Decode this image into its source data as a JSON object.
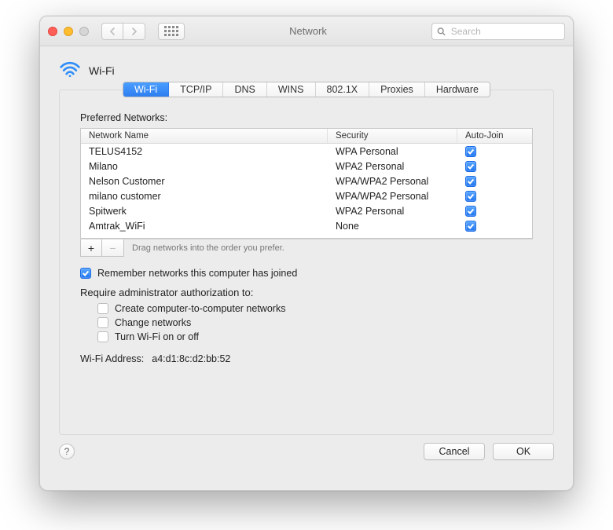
{
  "titlebar": {
    "title": "Network",
    "search_placeholder": "Search"
  },
  "header": {
    "title": "Wi-Fi"
  },
  "tabs": {
    "wifi": "Wi-Fi",
    "tcpip": "TCP/IP",
    "dns": "DNS",
    "wins": "WINS",
    "8021x": "802.1X",
    "proxies": "Proxies",
    "hardware": "Hardware"
  },
  "panel": {
    "preferred_label": "Preferred Networks:",
    "columns": {
      "name": "Network Name",
      "security": "Security",
      "autojoin": "Auto-Join"
    },
    "networks": [
      {
        "name": "TELUS4152",
        "security": "WPA Personal",
        "autojoin": true
      },
      {
        "name": "Milano",
        "security": "WPA2 Personal",
        "autojoin": true
      },
      {
        "name": "Nelson Customer",
        "security": "WPA/WPA2 Personal",
        "autojoin": true
      },
      {
        "name": "milano customer",
        "security": "WPA/WPA2 Personal",
        "autojoin": true
      },
      {
        "name": "Spitwerk",
        "security": "WPA2 Personal",
        "autojoin": true
      },
      {
        "name": "Amtrak_WiFi",
        "security": "None",
        "autojoin": true
      }
    ],
    "drag_hint": "Drag networks into the order you prefer.",
    "remember_label": "Remember networks this computer has joined",
    "remember_checked": true,
    "require_admin_label": "Require administrator authorization to:",
    "admin_opts": {
      "create": "Create computer-to-computer networks",
      "change": "Change networks",
      "toggle": "Turn Wi-Fi on or off"
    },
    "wifi_addr_label": "Wi-Fi Address:",
    "wifi_addr_value": "a4:d1:8c:d2:bb:52"
  },
  "footer": {
    "cancel": "Cancel",
    "ok": "OK"
  }
}
